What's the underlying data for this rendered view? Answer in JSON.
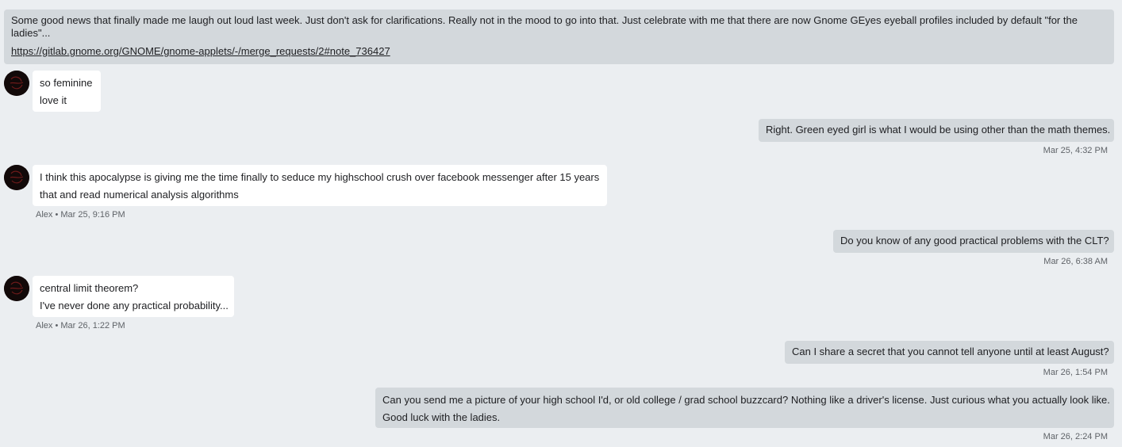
{
  "messages": {
    "top": {
      "text": "Some good news that finally made me laugh out loud last week. Just don't ask for clarifications. Really not in the mood to go into that. Just celebrate with me that there are now Gnome GEyes eyeball profiles included by default \"for the ladies\"...",
      "link": "https://gitlab.gnome.org/GNOME/gnome-applets/-/merge_requests/2#note_736427"
    },
    "m1": {
      "line1": "so feminine",
      "line2": "love it"
    },
    "m2": {
      "line1": "Right. Green eyed girl is what I would be using other than the math themes.",
      "meta": "Mar 25, 4:32 PM"
    },
    "m3": {
      "line1": "I think this apocalypse is giving me the time finally to seduce my highschool crush over facebook messenger after 15 years",
      "line2": "that and read numerical analysis algorithms",
      "meta": "Alex • Mar 25, 9:16 PM"
    },
    "m4": {
      "line1": "Do you know of any good practical problems with the CLT?",
      "meta": "Mar 26, 6:38 AM"
    },
    "m5": {
      "line1": "central limit theorem?",
      "line2": "I've never done any practical probability...",
      "meta": "Alex • Mar 26, 1:22 PM"
    },
    "m6": {
      "line1": "Can I share a secret that you cannot tell anyone until at least August?",
      "meta": "Mar 26, 1:54 PM"
    },
    "m7": {
      "line1": "Can you send me a picture of your high school I'd, or old college / grad school buzzcard? Nothing like a driver's license. Just curious what you actually look like.",
      "line2": "Good luck with the ladies.",
      "meta": "Mar 26, 2:24 PM"
    }
  },
  "colors": {
    "background": "#ebeef1",
    "outgoing_bubble": "#d3d8dc",
    "incoming_bubble": "#ffffff",
    "avatar": "#120909"
  },
  "icons": {
    "avatar": "contact-avatar-icon"
  }
}
